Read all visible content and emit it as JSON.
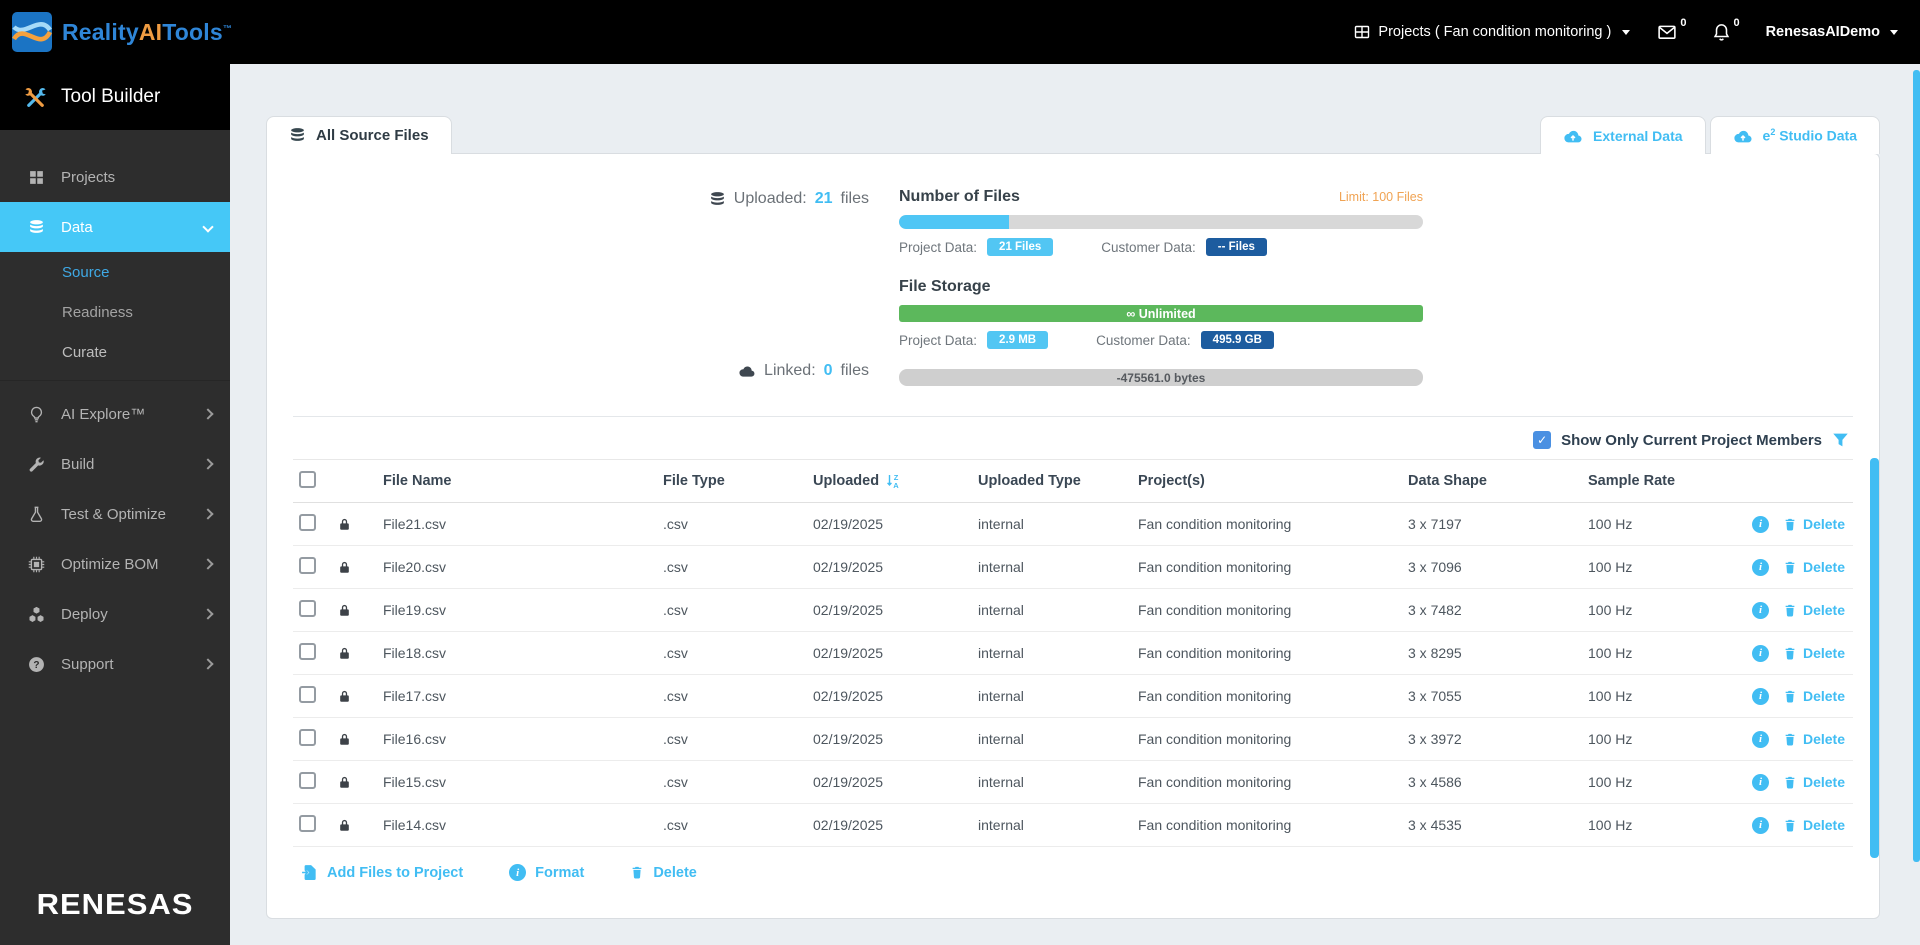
{
  "topbar": {
    "brand": {
      "part1": "Reality",
      "part2": "AI",
      "part3": "Tools",
      "tm": "™"
    },
    "projects_label": "Projects ( Fan condition monitoring )",
    "mail_badge": "0",
    "notif_badge": "0",
    "username": "RenesasAIDemo"
  },
  "sidebar": {
    "tool_builder": "Tool Builder",
    "projects": "Projects",
    "data": "Data",
    "source": "Source",
    "readiness": "Readiness",
    "curate": "Curate",
    "ai_explore": "AI Explore™",
    "build": "Build",
    "test_optimize": "Test & Optimize",
    "optimize_bom": "Optimize BOM",
    "deploy": "Deploy",
    "support": "Support",
    "logo": "RENESAS"
  },
  "tabs": {
    "all_source_files": "All Source Files",
    "external_data": "External Data",
    "studio_base": "e",
    "studio_sup": "2",
    "studio_rest": "Studio Data"
  },
  "stats": {
    "uploaded_label": "Uploaded:",
    "uploaded_count": "21",
    "uploaded_suffix": "files",
    "linked_label": "Linked:",
    "linked_count": "0",
    "linked_suffix": "files",
    "number_of_files": {
      "title": "Number of Files",
      "limit": "Limit: 100 Files",
      "percent": 21,
      "project_label": "Project Data:",
      "project_value": "21 Files",
      "customer_label": "Customer Data:",
      "customer_value": "-- Files"
    },
    "file_storage": {
      "title": "File Storage",
      "bar_text": "∞ Unlimited",
      "project_label": "Project Data:",
      "project_value": "2.9 MB",
      "customer_label": "Customer Data:",
      "customer_value": "495.9 GB"
    },
    "linked_bar_text": "-475561.0 bytes"
  },
  "filter": {
    "label": "Show Only Current Project Members",
    "checked": true
  },
  "table": {
    "headers": {
      "name": "File Name",
      "type": "File Type",
      "uploaded": "Uploaded",
      "uploaded_type": "Uploaded Type",
      "projects": "Project(s)",
      "shape": "Data Shape",
      "rate": "Sample Rate"
    },
    "delete_label": "Delete",
    "rows": [
      {
        "name": "File21.csv",
        "type": ".csv",
        "uploaded": "02/19/2025",
        "uploaded_type": "internal",
        "project": "Fan condition monitoring",
        "shape": "3 x 7197",
        "rate": "100 Hz"
      },
      {
        "name": "File20.csv",
        "type": ".csv",
        "uploaded": "02/19/2025",
        "uploaded_type": "internal",
        "project": "Fan condition monitoring",
        "shape": "3 x 7096",
        "rate": "100 Hz"
      },
      {
        "name": "File19.csv",
        "type": ".csv",
        "uploaded": "02/19/2025",
        "uploaded_type": "internal",
        "project": "Fan condition monitoring",
        "shape": "3 x 7482",
        "rate": "100 Hz"
      },
      {
        "name": "File18.csv",
        "type": ".csv",
        "uploaded": "02/19/2025",
        "uploaded_type": "internal",
        "project": "Fan condition monitoring",
        "shape": "3 x 8295",
        "rate": "100 Hz"
      },
      {
        "name": "File17.csv",
        "type": ".csv",
        "uploaded": "02/19/2025",
        "uploaded_type": "internal",
        "project": "Fan condition monitoring",
        "shape": "3 x 7055",
        "rate": "100 Hz"
      },
      {
        "name": "File16.csv",
        "type": ".csv",
        "uploaded": "02/19/2025",
        "uploaded_type": "internal",
        "project": "Fan condition monitoring",
        "shape": "3 x 3972",
        "rate": "100 Hz"
      },
      {
        "name": "File15.csv",
        "type": ".csv",
        "uploaded": "02/19/2025",
        "uploaded_type": "internal",
        "project": "Fan condition monitoring",
        "shape": "3 x 4586",
        "rate": "100 Hz"
      },
      {
        "name": "File14.csv",
        "type": ".csv",
        "uploaded": "02/19/2025",
        "uploaded_type": "internal",
        "project": "Fan condition monitoring",
        "shape": "3 x 4535",
        "rate": "100 Hz"
      }
    ]
  },
  "footer_actions": {
    "add": "Add Files to Project",
    "format": "Format",
    "delete": "Delete"
  },
  "icons": {
    "check": "✓",
    "info": "i",
    "question": "?",
    "sort_top": "Z",
    "sort_bottom": "A"
  },
  "colors": {
    "accent": "#41bdf3",
    "nav_active": "#45c8f7",
    "green": "#5cb85c",
    "navy": "#1d5c9f",
    "orange": "#f09c42"
  }
}
